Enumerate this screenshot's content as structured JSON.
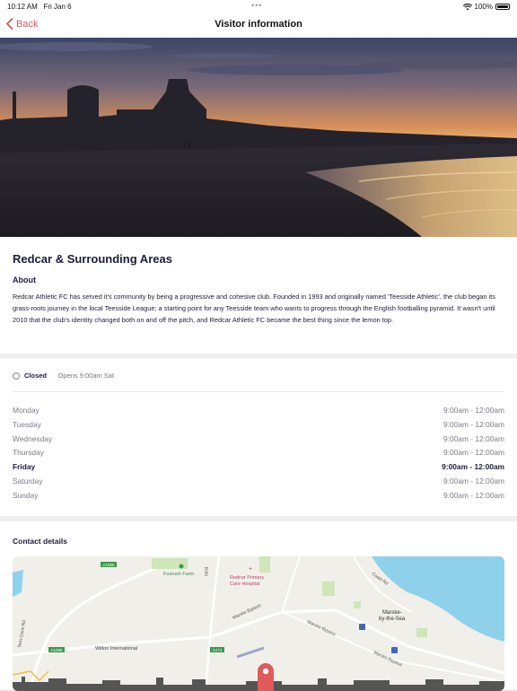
{
  "status_bar": {
    "time": "10:12 AM",
    "date": "Fri Jan 6",
    "battery": "100%"
  },
  "nav": {
    "back_label": "Back",
    "title": "Visitor information"
  },
  "area": {
    "title": "Redcar & Surrounding Areas",
    "about_label": "About",
    "about_text": "Redcar Athletic FC has served it's community by being a progressive and cohesive club. Founded in 1993 and originally named 'Teesside Athletic', the club began its grass-roots journey in the local Teesside League; a starting point for any Teesside team who wants to progress through the English footballing pyramid. It wasn't until 2010 that the club's identity changed both on and off the pitch, and Redcar Athletic FC became the best thing since the lemon top."
  },
  "opening": {
    "status": "Closed",
    "separator": "·",
    "next": "Opens 9:00am Sat",
    "days": [
      {
        "day": "Monday",
        "hours": "9:00am - 12:00am"
      },
      {
        "day": "Tuesday",
        "hours": "9:00am - 12:00am"
      },
      {
        "day": "Wednesday",
        "hours": "9:00am - 12:00am"
      },
      {
        "day": "Thursday",
        "hours": "9:00am - 12:00am"
      },
      {
        "day": "Friday",
        "hours": "9:00am - 12:00am"
      },
      {
        "day": "Saturday",
        "hours": "9:00am - 12:00am"
      },
      {
        "day": "Sunday",
        "hours": "9:00am - 12:00am"
      }
    ]
  },
  "contact": {
    "title": "Contact details",
    "map": {
      "labels": {
        "foxrush": "Foxrush Farm",
        "hospital_1": "Redcar Primary",
        "hospital_2": "Care Hospital",
        "marske_1": "Marske-",
        "marske_2": "by-the-Sea",
        "coast_rd": "Coast Rd",
        "bypass_1": "Marske Bypass",
        "bypass_2": "Marske Bypass",
        "bypass_3": "Marske Bypass",
        "tees_dock": "Tees Dock Rd",
        "wilton": "Wilton International",
        "kirkleatham": "Kirkl",
        "a1085_top": "A1085",
        "a1085_bottom": "A1085",
        "a174": "A174"
      }
    }
  },
  "colors": {
    "accent": "#d35a5a",
    "text_dark": "#1c1c3a",
    "text_muted": "#7a7a8a",
    "map_sea": "#7fc8e8",
    "map_land": "#f1efe9"
  }
}
